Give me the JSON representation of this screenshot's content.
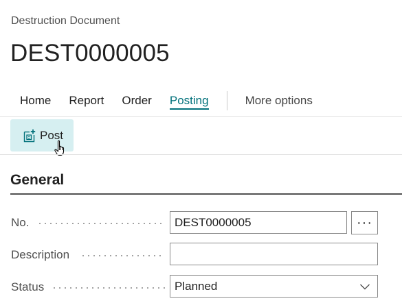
{
  "header": {
    "caption": "Destruction Document",
    "title": "DEST0000005"
  },
  "tabs": [
    {
      "label": "Home"
    },
    {
      "label": "Report"
    },
    {
      "label": "Order"
    },
    {
      "label": "Posting",
      "active": true
    }
  ],
  "more_options_label": "More options",
  "actions": {
    "post_label": "Post",
    "post_icon": "post-document-icon"
  },
  "section": {
    "title": "General"
  },
  "fields": {
    "no": {
      "label": "No.",
      "value": "DEST0000005",
      "lookup_label": "···"
    },
    "description": {
      "label": "Description",
      "value": ""
    },
    "status": {
      "label": "Status",
      "value": "Planned"
    }
  },
  "colors": {
    "accent": "#00707a",
    "action_bg": "#d6eff1"
  }
}
